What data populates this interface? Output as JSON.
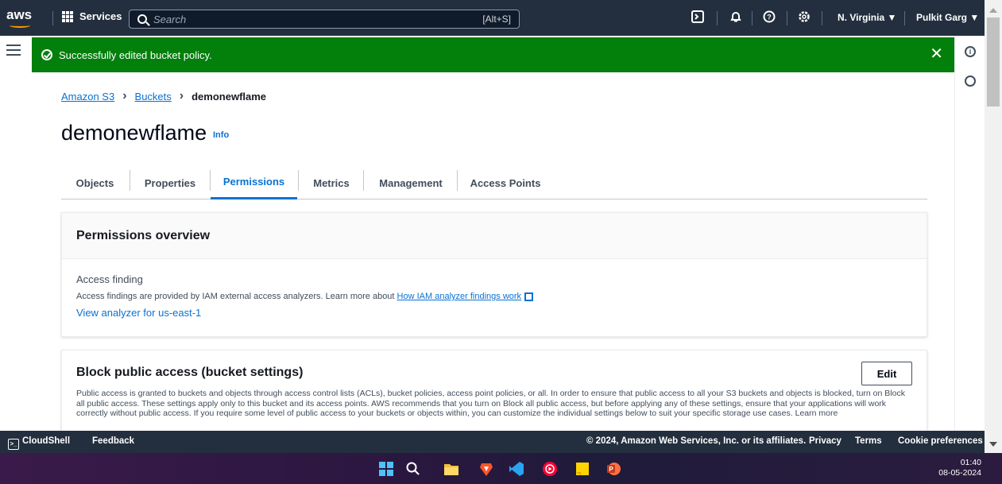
{
  "nav": {
    "logo": "aws",
    "services_label": "Services",
    "search_placeholder": "Search",
    "search_shortcut": "[Alt+S]",
    "region": "N. Virginia ▼",
    "user": "Pulkit Garg ▼"
  },
  "flash": {
    "message": "Successfully edited bucket policy.",
    "close": "✕",
    "color": "#037f0c"
  },
  "breadcrumb": {
    "items": [
      "Amazon S3",
      "Buckets"
    ],
    "separator": "›",
    "current": "demonewflame"
  },
  "page": {
    "title": "demonewflame",
    "info": "Info"
  },
  "tabs": [
    "Objects",
    "Properties",
    "Permissions",
    "Metrics",
    "Management",
    "Access Points"
  ],
  "active_tab": "Permissions",
  "permissions_overview": {
    "title": "Permissions overview",
    "access_finding_label": "Access finding",
    "description": "Access findings are provided by IAM external access analyzers. Learn more about ",
    "learn_link": "How IAM analyzer findings work",
    "view_link": "View analyzer for us-east-1"
  },
  "block_public_access": {
    "title": "Block public access (bucket settings)",
    "edit_label": "Edit",
    "description": "Public access is granted to buckets and objects through access control lists (ACLs), bucket policies, access point policies, or all. In order to ensure that public access to all your S3 buckets and objects is blocked, turn on Block all public access. These settings apply only to this bucket and its access points. AWS recommends that you turn on Block all public access, but before applying any of these settings, ensure that your applications will work correctly without public access. If you require some level of public access to your buckets or objects within, you can customize the individual settings below to suit your specific storage use cases. Learn more"
  },
  "footer": {
    "cloudshell": "CloudShell",
    "feedback": "Feedback",
    "copyright": "© 2024, Amazon Web Services, Inc. or its affiliates.",
    "privacy": "Privacy",
    "terms": "Terms",
    "cookie": "Cookie preferences"
  },
  "taskbar": {
    "time": "01:40",
    "date": "08-05-2024",
    "icons": [
      "windows-start-icon",
      "search-icon",
      "file-explorer-icon",
      "brave-browser-icon",
      "vscode-icon",
      "youtube-music-icon",
      "sticky-notes-icon",
      "powerpoint-icon"
    ]
  }
}
